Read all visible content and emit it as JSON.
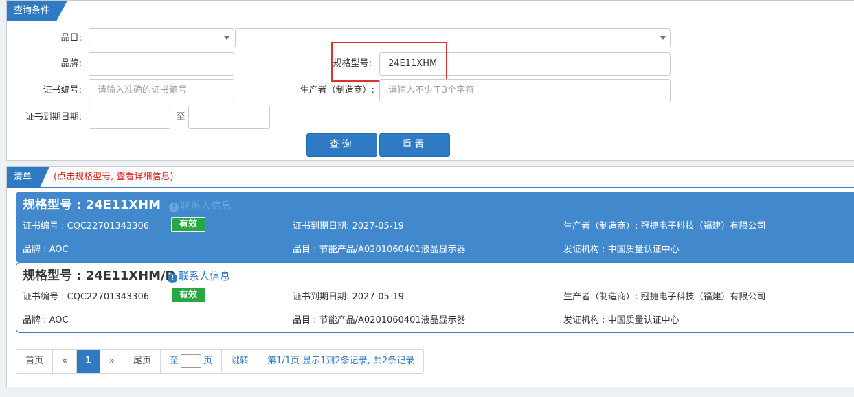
{
  "query_panel": {
    "tab_label": "查询条件",
    "category_label": "品目:",
    "category_value_1": "",
    "category_value_2": "",
    "brand_label": "品牌:",
    "brand_value": "",
    "model_label": "规格型号:",
    "model_value": "24E11XHM",
    "cert_no_label": "证书编号:",
    "cert_no_placeholder": "请输入准确的证书编号",
    "manufacturer_label": "生产者（制造商）:",
    "manufacturer_placeholder": "请输入不少于3个字符",
    "expiry_label": "证书到期日期:",
    "expiry_from": "",
    "expiry_to": "",
    "expiry_sep": "至",
    "query_button": "查询",
    "reset_button": "重置"
  },
  "list_panel": {
    "tab_label": "清单",
    "hint": "(点击规格型号, 查看详细信息)",
    "records": [
      {
        "model": "规格型号 : 24E11XHM",
        "contact": "联系人信息",
        "cert_no": "证书编号 : CQC22701343306",
        "status": "有效",
        "expiry": "证书到期日期: 2027-05-19",
        "manufacturer": "生产者（制造商）: 冠捷电子科技（福建）有限公司",
        "brand": "品牌 : AOC",
        "category": "品目 : 节能产品/A0201060401液晶显示器",
        "issuer": "发证机构 : 中国质量认证中心"
      },
      {
        "model": "规格型号 : 24E11XHM/D",
        "contact": "联系人信息",
        "cert_no": "证书编号 : CQC22701343306",
        "status": "有效",
        "expiry": "证书到期日期: 2027-05-19",
        "manufacturer": "生产者（制造商）: 冠捷电子科技（福建）有限公司",
        "brand": "品牌 : AOC",
        "category": "品目 : 节能产品/A0201060401液晶显示器",
        "issuer": "发证机构 : 中国质量认证中心"
      }
    ]
  },
  "pagination": {
    "first": "首页",
    "prev": "«",
    "current": "1",
    "next": "»",
    "last": "尾页",
    "goto_prefix": "至",
    "goto_suffix": "页",
    "jump": "跳转",
    "summary": "第1/1页  显示1到2条记录, 共2条记录"
  },
  "colors": {
    "accent": "#2e7bc4",
    "active_row": "#4189cc",
    "valid_badge": "#27a844",
    "highlight_box": "#e03030",
    "hint_red": "#d9261c"
  }
}
